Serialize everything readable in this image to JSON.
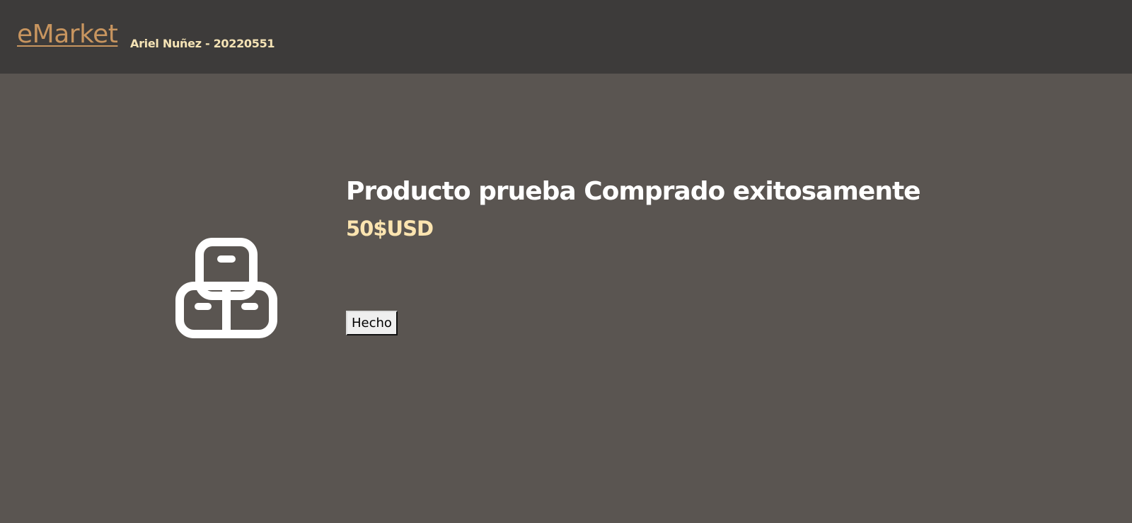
{
  "header": {
    "brand": "eMarket",
    "author": "Ariel Nuñez - 20220551"
  },
  "product": {
    "icon": "boxes-icon",
    "title": "Producto prueba Comprado exitosamente",
    "price": "50$USD"
  },
  "actions": {
    "done_label": "Hecho"
  },
  "colors": {
    "header_bg": "#3d3b3a",
    "page_bg": "#5a5551",
    "brand": "#c8955f",
    "accent_text": "#fbe4b0",
    "title": "#ffffff"
  }
}
